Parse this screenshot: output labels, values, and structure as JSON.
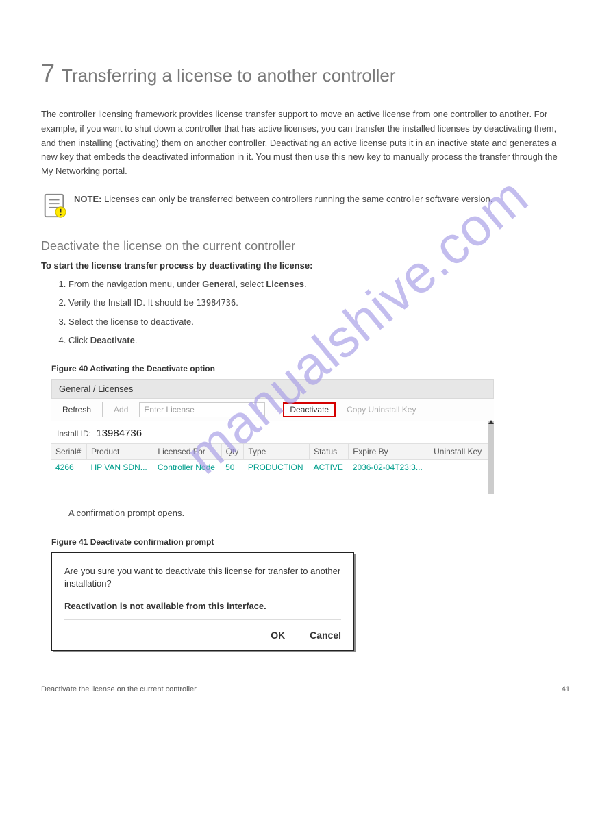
{
  "watermark": "manualshive.com",
  "chapter": {
    "number": "7",
    "title": "Transferring a license to another controller"
  },
  "intro": "The controller licensing framework provides license transfer support to move an active license from one controller to another. For example, if you want to shut down a controller that has active licenses, you can transfer the installed licenses by deactivating them, and then installing (activating) them on another controller. Deactivating an active license puts it in an inactive state and generates a new key that embeds the deactivated information in it. You must then use this new key to manually process the transfer through the My Networking portal.",
  "note": {
    "label": "NOTE:",
    "text": "Licenses can only be transferred between controllers running the same controller software version."
  },
  "section_title": "Deactivate the license on the current controller",
  "steps_intro": "To start the license transfer process by deactivating the license:",
  "steps": [
    {
      "n": "1.",
      "html": "From the navigation menu, under <b>General</b>, select <b>Licenses</b>."
    },
    {
      "n": "2.",
      "html": "Verify the Install ID. It should be <code>13984736</code>."
    },
    {
      "n": "3.",
      "html": "Select the license to deactivate."
    },
    {
      "n": "4.",
      "html": "Click <b>Deactivate</b>."
    }
  ],
  "figure1": {
    "label": "Figure 40",
    "title": "Activating the Deactivate option"
  },
  "screenshot1": {
    "breadcrumb": "General / Licenses",
    "buttons": {
      "refresh": "Refresh",
      "add": "Add",
      "deactivate": "Deactivate",
      "copy": "Copy Uninstall Key"
    },
    "input_placeholder": "Enter License",
    "install_label": "Install ID:",
    "install_value": "13984736",
    "headers": [
      "Serial#",
      "Product",
      "Licensed For",
      "Qty",
      "Type",
      "Status",
      "Expire By",
      "Uninstall Key"
    ],
    "row": {
      "serial": "4266",
      "product": "HP VAN SDN...",
      "licensed_for": "Controller Node",
      "qty": "50",
      "type": "PRODUCTION",
      "status": "ACTIVE",
      "expire": "2036-02-04T23:3..."
    }
  },
  "confirm_sentence": "A confirmation prompt opens.",
  "figure2": {
    "label": "Figure 41",
    "title": "Deactivate confirmation prompt"
  },
  "dialog": {
    "question": "Are you sure you want to deactivate this license for transfer to another installation?",
    "warning": "Reactivation is not available from this interface.",
    "ok": "OK",
    "cancel": "Cancel"
  },
  "footer": {
    "left": "Deactivate the license on the current controller",
    "right": "41"
  }
}
